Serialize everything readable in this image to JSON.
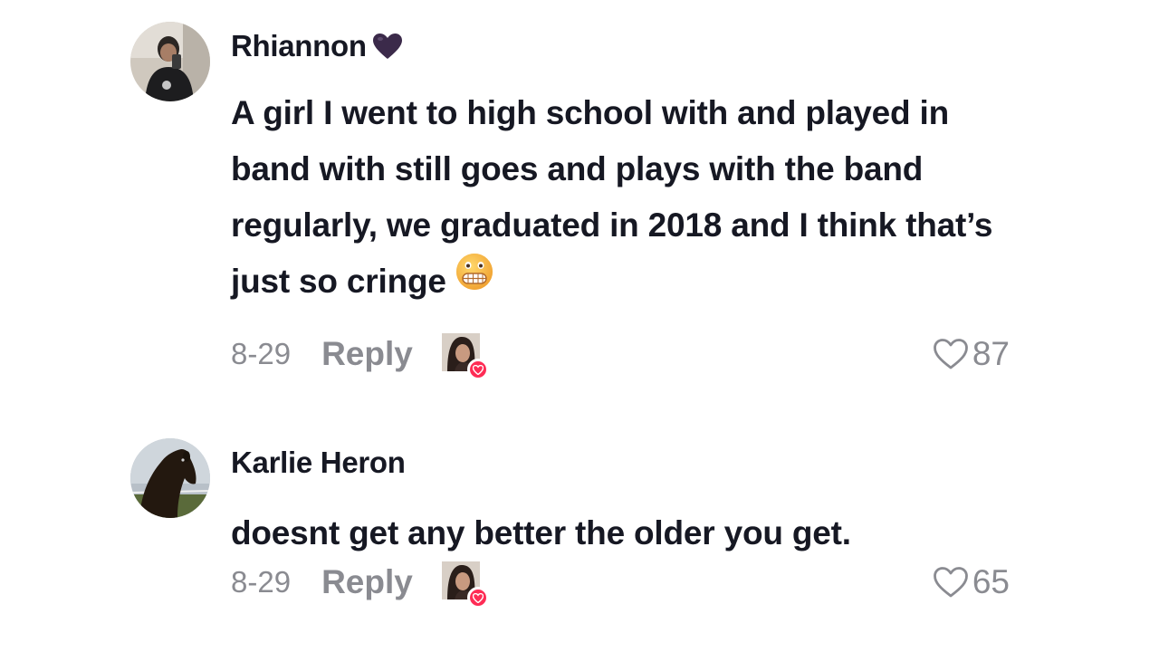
{
  "comments": [
    {
      "username": "Rhiannon",
      "username_badge": "purple-heart-icon",
      "text": "A girl I went to high school with and played in band with still goes and plays with the band regularly, we graduated in 2018 and I think that’s just so cringe",
      "emoji": "grimacing-face-icon",
      "date": "8-29",
      "reply_label": "Reply",
      "likes": "87",
      "liked_by_creator": true
    },
    {
      "username": "Karlie Heron",
      "text": "doesnt get any better the older you get.",
      "date": "8-29",
      "reply_label": "Reply",
      "likes": "65",
      "liked_by_creator": true
    }
  ],
  "colors": {
    "text_primary": "#161823",
    "text_secondary": "#8a8b91",
    "like_accent": "#fe2c55",
    "badge_heart": "#3b2a4a"
  }
}
